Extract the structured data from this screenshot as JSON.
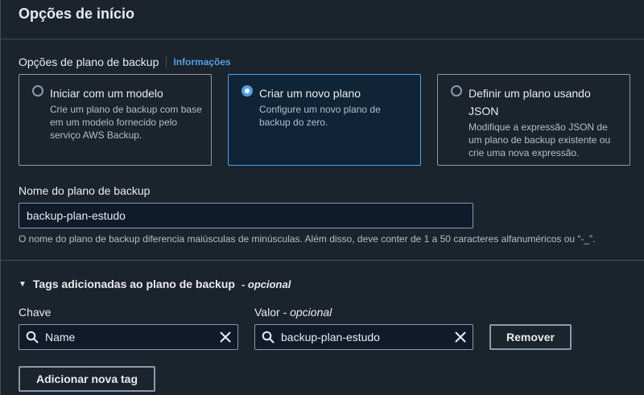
{
  "header": {
    "title": "Opções de início"
  },
  "start_options": {
    "label": "Opções de plano de backup",
    "info_link": "Informações",
    "tiles": [
      {
        "title": "Iniciar com um modelo",
        "description": "Crie um plano de backup com base em um modelo fornecido pelo serviço AWS Backup.",
        "selected": false
      },
      {
        "title": "Criar um novo plano",
        "description": "Configure um novo plano de backup do zero.",
        "selected": true
      },
      {
        "title": "Definir um plano usando JSON",
        "description": "Modifique a expressão JSON de um plano de backup existente ou crie uma nova expressão.",
        "selected": false
      }
    ]
  },
  "plan_name": {
    "label": "Nome do plano de backup",
    "value": "backup-plan-estudo",
    "hint": "O nome do plano de backup diferencia maiúsculas de minúsculas. Além disso, deve conter de 1 a 50 caracteres alfanuméricos ou “-_”."
  },
  "tags": {
    "title": "Tags adicionadas ao plano de backup",
    "optional_label": "- opcional",
    "key_label": "Chave",
    "value_label": "Valor",
    "value_optional": "- opcional",
    "key_value": "Name",
    "value_value": "backup-plan-estudo",
    "remove_label": "Remover",
    "add_label": "Adicionar nova tag"
  },
  "colors": {
    "accent": "#539fe5",
    "panel": "#1b232d",
    "border": "#8d99a8"
  }
}
